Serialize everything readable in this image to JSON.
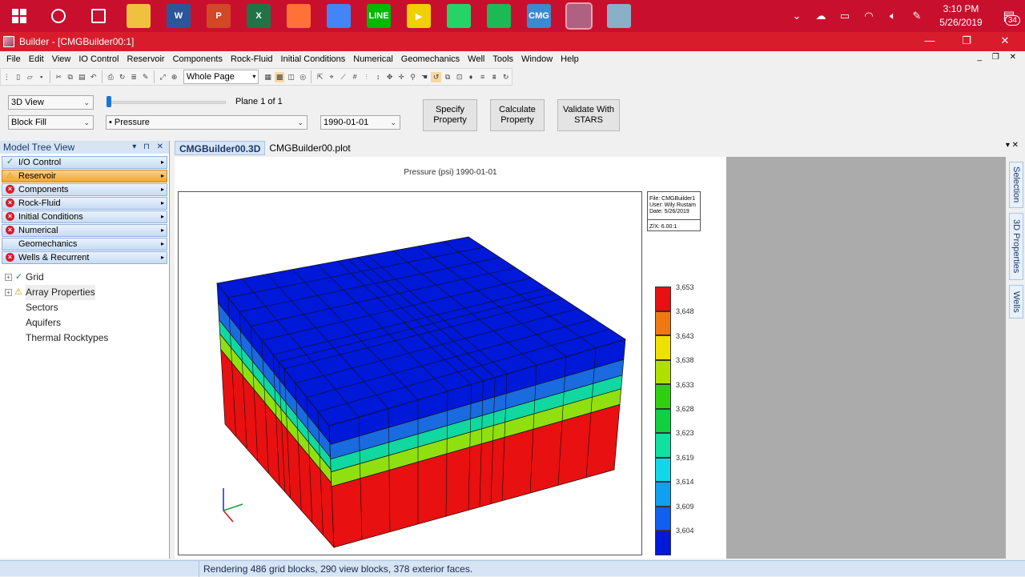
{
  "taskbar": {
    "apps": [
      {
        "name": "cortana-icon",
        "label": "",
        "color": "#c8102e"
      },
      {
        "name": "task-view-icon",
        "label": "",
        "color": "#c8102e"
      },
      {
        "name": "file-explorer-icon",
        "label": "",
        "color": "#f0c040"
      },
      {
        "name": "word-icon",
        "label": "W",
        "color": "#2b579a"
      },
      {
        "name": "powerpoint-icon",
        "label": "P",
        "color": "#d24726"
      },
      {
        "name": "excel-icon",
        "label": "X",
        "color": "#217346"
      },
      {
        "name": "firefox-icon",
        "label": "",
        "color": "#ff7139"
      },
      {
        "name": "chrome-icon",
        "label": "",
        "color": "#4285f4"
      },
      {
        "name": "line-icon",
        "label": "LINE",
        "color": "#00b900"
      },
      {
        "name": "player-icon",
        "label": "▶",
        "color": "#f0d000"
      },
      {
        "name": "whatsapp-icon",
        "label": "",
        "color": "#25d366"
      },
      {
        "name": "spotify-icon",
        "label": "",
        "color": "#1db954"
      },
      {
        "name": "cmg-launcher-icon",
        "label": "CMG",
        "color": "#3a8ad0"
      },
      {
        "name": "builder-icon",
        "label": "",
        "color": "#b06080"
      },
      {
        "name": "notes-icon",
        "label": "",
        "color": "#8ab0c8"
      }
    ],
    "clock_time": "3:10 PM",
    "clock_date": "5/26/2019",
    "notification_count": "34"
  },
  "window": {
    "title": "Builder - [CMGBuilder00:1]"
  },
  "menu": [
    "File",
    "Edit",
    "View",
    "IO Control",
    "Reservoir",
    "Components",
    "Rock-Fluid",
    "Initial Conditions",
    "Numerical",
    "Geomechanics",
    "Well",
    "Tools",
    "Window",
    "Help"
  ],
  "toolbar": {
    "zoom_value": "Whole Page"
  },
  "controls": {
    "view_mode": "3D View",
    "fill_mode": "Block Fill",
    "plane_label": "Plane 1 of 1",
    "property": "• Pressure",
    "date": "1990-01-01",
    "specify_property": "Specify Property",
    "calculate_property": "Calculate Property",
    "validate": "Validate With STARS"
  },
  "tree": {
    "header": "Model Tree View",
    "sections": [
      {
        "label": "I/O Control",
        "status": "ok"
      },
      {
        "label": "Reservoir",
        "status": "warn",
        "active": true
      },
      {
        "label": "Components",
        "status": "error"
      },
      {
        "label": "Rock-Fluid",
        "status": "error"
      },
      {
        "label": "Initial Conditions",
        "status": "error"
      },
      {
        "label": "Numerical",
        "status": "error"
      },
      {
        "label": "Geomechanics",
        "status": "none"
      },
      {
        "label": "Wells & Recurrent",
        "status": "error"
      }
    ],
    "nodes": [
      {
        "label": "Grid",
        "expander": true,
        "mark": "check"
      },
      {
        "label": "Array Properties",
        "expander": true,
        "mark": "warn"
      },
      {
        "label": "Sectors",
        "expander": false,
        "mark": ""
      },
      {
        "label": "Aquifers",
        "expander": false,
        "mark": ""
      },
      {
        "label": "Thermal Rocktypes",
        "expander": false,
        "mark": ""
      }
    ]
  },
  "tabs": [
    "CMGBuilder00.3D",
    "CMGBuilder00.plot"
  ],
  "plot": {
    "title": "Pressure (psi) 1990-01-01",
    "info_lines": [
      "File: CMGBuilder1",
      "User: Wily Rustam",
      "Date: 5/26/2019",
      "Z/X: 6.00:1"
    ]
  },
  "legend": {
    "labels": [
      "3,653",
      "3,648",
      "3,643",
      "3,638",
      "3,633",
      "3,628",
      "3,623",
      "3,619",
      "3,614",
      "3,609",
      "3,604"
    ],
    "colors": [
      "#e81010",
      "#f07810",
      "#f0e000",
      "#b0e000",
      "#30d010",
      "#10d040",
      "#10e0a0",
      "#10d8e8",
      "#10a0f0",
      "#1060f0",
      "#0018d8"
    ]
  },
  "sidetabs": [
    "Selection",
    "3D Properties",
    "Wells"
  ],
  "status": {
    "text": "Rendering 486 grid blocks, 290 view blocks, 378 exterior faces."
  }
}
